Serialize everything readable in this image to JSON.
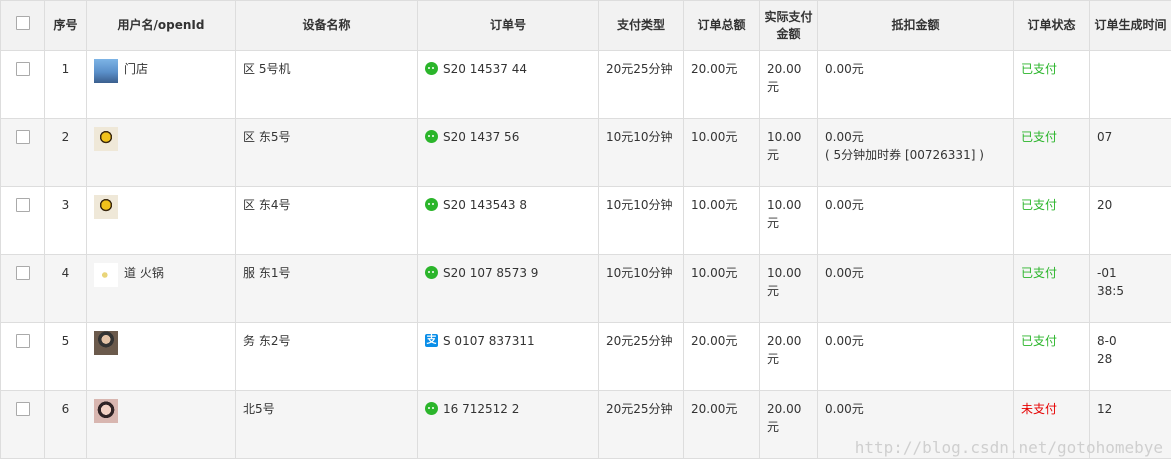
{
  "table": {
    "headers": {
      "index": "序号",
      "user": "用户名/openId",
      "device": "设备名称",
      "order_no": "订单号",
      "pay_type": "支付类型",
      "total": "订单总额",
      "actual": "实际支付金额",
      "deduction": "抵扣金额",
      "status": "订单状态",
      "created": "订单生成时间"
    },
    "rows": [
      {
        "index": "1",
        "user": "门店",
        "avatar": "sky",
        "device": "区 5号机",
        "pay_icon": "wechat-icon",
        "order_no": "S20 14537 44",
        "pay_type": "20元25分钟",
        "total": "20.00元",
        "actual": "20.00元",
        "deduction": "0.00元",
        "deduction_note": "",
        "status": "已支付",
        "status_kind": "paid",
        "created_line1": "",
        "created_line2": ""
      },
      {
        "index": "2",
        "user": "",
        "avatar": "flower",
        "device": "区 东5号",
        "pay_icon": "wechat-icon",
        "order_no": "S20 1437 56",
        "pay_type": "10元10分钟",
        "total": "10.00元",
        "actual": "10.00元",
        "deduction": "0.00元",
        "deduction_note": "( 5分钟加时券 [00726331] )",
        "status": "已支付",
        "status_kind": "paid",
        "created_line1": "",
        "created_line2": "07"
      },
      {
        "index": "3",
        "user": "",
        "avatar": "flower",
        "device": "区 东4号",
        "pay_icon": "wechat-icon",
        "order_no": "S20 143543 8",
        "pay_type": "10元10分钟",
        "total": "10.00元",
        "actual": "10.00元",
        "deduction": "0.00元",
        "deduction_note": "",
        "status": "已支付",
        "status_kind": "paid",
        "created_line1": "20",
        "created_line2": ""
      },
      {
        "index": "4",
        "user": "道 火锅",
        "avatar": "noodle",
        "device": "服 东1号",
        "pay_icon": "wechat-icon",
        "order_no": "S20 107 8573 9",
        "pay_type": "10元10分钟",
        "total": "10.00元",
        "actual": "10.00元",
        "deduction": "0.00元",
        "deduction_note": "",
        "status": "已支付",
        "status_kind": "paid",
        "created_line1": "-01",
        "created_line2": "38:5"
      },
      {
        "index": "5",
        "user": "",
        "avatar": "person",
        "device": "务 东2号",
        "pay_icon": "alipay-icon",
        "order_no": "S 0107 837311",
        "pay_type": "20元25分钟",
        "total": "20.00元",
        "actual": "20.00元",
        "deduction": "0.00元",
        "deduction_note": "",
        "status": "已支付",
        "status_kind": "paid",
        "created_line1": "8-0",
        "created_line2": "28"
      },
      {
        "index": "6",
        "user": "",
        "avatar": "girl",
        "device": "北5号",
        "pay_icon": "wechat-icon",
        "order_no": "16 712512 2",
        "pay_type": "20元25分钟",
        "total": "20.00元",
        "actual": "20.00元",
        "deduction": "0.00元",
        "deduction_note": "",
        "status": "未支付",
        "status_kind": "unpaid",
        "created_line1": "",
        "created_line2": "12"
      }
    ]
  },
  "watermark": "http://blog.csdn.net/gotohomebye",
  "colors": {
    "paid": "#2bb52b",
    "unpaid": "#e60000",
    "header_bg": "#f2f2f2",
    "row_alt_bg": "#f5f5f5"
  }
}
